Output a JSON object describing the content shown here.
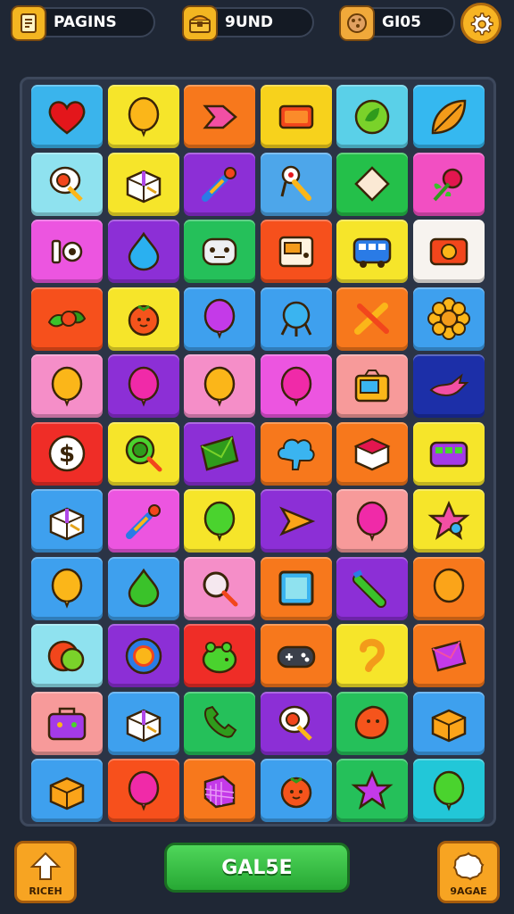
{
  "topbar": {
    "pill1": {
      "label": "PAGINS",
      "icon": "document-icon"
    },
    "pill2": {
      "label": "9UND",
      "icon": "treasure-chest-icon"
    },
    "pill3": {
      "label": "GI05",
      "icon": "cookie-icon"
    },
    "settings_icon": "gear-icon"
  },
  "board": {
    "rows": [
      [
        {
          "icon": "heart",
          "bg": "#3ab4ec"
        },
        {
          "icon": "balloon-yellow",
          "bg": "#f6e52a"
        },
        {
          "icon": "arrow-pink",
          "bg": "#f7781c"
        },
        {
          "icon": "card-red",
          "bg": "#f7d21c"
        },
        {
          "icon": "leaf-coin",
          "bg": "#5ad0e8"
        },
        {
          "icon": "leaf-orange",
          "bg": "#35b8f0"
        }
      ],
      [
        {
          "icon": "magnifier-egg",
          "bg": "#8fe2ef"
        },
        {
          "icon": "gift-box",
          "bg": "#f6e52a"
        },
        {
          "icon": "dropper",
          "bg": "#8c2fd6"
        },
        {
          "icon": "key-tool",
          "bg": "#4da6ea"
        },
        {
          "icon": "diamond-white",
          "bg": "#24c04a"
        },
        {
          "icon": "berry-plant",
          "bg": "#f24fc2"
        }
      ],
      [
        {
          "icon": "bottle-cap",
          "bg": "#ec55e0"
        },
        {
          "icon": "drop-blue",
          "bg": "#8c2fd6"
        },
        {
          "icon": "robot-face",
          "bg": "#25c05a"
        },
        {
          "icon": "radio-box",
          "bg": "#f6501c"
        },
        {
          "icon": "bus-blue",
          "bg": "#f6e52a"
        },
        {
          "icon": "radio-orange",
          "bg": "#f7f3ef"
        }
      ],
      [
        {
          "icon": "holly",
          "bg": "#f6501c"
        },
        {
          "icon": "tomato",
          "bg": "#f6e52a"
        },
        {
          "icon": "balloon-purple",
          "bg": "#3ea0ee"
        },
        {
          "icon": "spider-blue",
          "bg": "#3ea0ee"
        },
        {
          "icon": "cross-tools",
          "bg": "#f7781c"
        },
        {
          "icon": "flower-sun",
          "bg": "#3ea0ee"
        }
      ],
      [
        {
          "icon": "balloon-yellow",
          "bg": "#f58ec8"
        },
        {
          "icon": "balloon-magenta",
          "bg": "#8c2fd6"
        },
        {
          "icon": "balloon-yellow",
          "bg": "#f58ec8"
        },
        {
          "icon": "balloon-magenta",
          "bg": "#ec55e0"
        },
        {
          "icon": "radio-yellow",
          "bg": "#f79a9a"
        },
        {
          "icon": "bird-pink",
          "bg": "#1c2fa8"
        }
      ],
      [
        {
          "icon": "dollar-coin",
          "bg": "#ef2d27"
        },
        {
          "icon": "magnifier-green",
          "bg": "#f6e52a"
        },
        {
          "icon": "envelope-green",
          "bg": "#8c2fd6"
        },
        {
          "icon": "cloud-blue",
          "bg": "#f7781c"
        },
        {
          "icon": "box-pink",
          "bg": "#f7781c"
        },
        {
          "icon": "bus-purple",
          "bg": "#f6e52a"
        }
      ],
      [
        {
          "icon": "gift-box",
          "bg": "#3ea0ee"
        },
        {
          "icon": "dropper",
          "bg": "#ec55e0"
        },
        {
          "icon": "balloon-green",
          "bg": "#f6e52a"
        },
        {
          "icon": "arrow-orange",
          "bg": "#8c2fd6"
        },
        {
          "icon": "balloon-magenta",
          "bg": "#f79a9a"
        },
        {
          "icon": "star-pink",
          "bg": "#f6e52a"
        }
      ],
      [
        {
          "icon": "balloon-yellow",
          "bg": "#3ea0ee"
        },
        {
          "icon": "drop-green",
          "bg": "#3ea0ee"
        },
        {
          "icon": "magnifier",
          "bg": "#f58ec8"
        },
        {
          "icon": "screen",
          "bg": "#f7781c"
        },
        {
          "icon": "crayon",
          "bg": "#8c2fd6"
        },
        {
          "icon": "balloon-orange",
          "bg": "#f7781c"
        }
      ],
      [
        {
          "icon": "ball-mix",
          "bg": "#8fe2ef"
        },
        {
          "icon": "ring-ball",
          "bg": "#8c2fd6"
        },
        {
          "icon": "frog",
          "bg": "#ef2d27"
        },
        {
          "icon": "gamepad",
          "bg": "#f7781c"
        },
        {
          "icon": "hook",
          "bg": "#f6e52a"
        },
        {
          "icon": "box-purple",
          "bg": "#f7781c"
        }
      ],
      [
        {
          "icon": "bag-purple",
          "bg": "#f79a9a"
        },
        {
          "icon": "gift-box",
          "bg": "#3ea0ee"
        },
        {
          "icon": "phone",
          "bg": "#25c05a"
        },
        {
          "icon": "magnifier-egg",
          "bg": "#8c2fd6"
        },
        {
          "icon": "blob-orange",
          "bg": "#25c05a"
        },
        {
          "icon": "box-orange",
          "bg": "#3ea0ee"
        }
      ],
      [
        {
          "icon": "box-orange",
          "bg": "#3ea0ee"
        },
        {
          "icon": "balloon-magenta",
          "bg": "#f7501c"
        },
        {
          "icon": "cube-grid",
          "bg": "#f7781c"
        },
        {
          "icon": "tomato",
          "bg": "#3ea0ee"
        },
        {
          "icon": "star-purple",
          "bg": "#25c05a"
        },
        {
          "icon": "balloon-green",
          "bg": "#22c7d8"
        }
      ]
    ]
  },
  "bottom": {
    "left_label": "RICEH",
    "left_icon": "up-arrow-icon",
    "main_label": "GAL5E",
    "right_label": "9AGAE",
    "right_icon": "splat-icon"
  }
}
